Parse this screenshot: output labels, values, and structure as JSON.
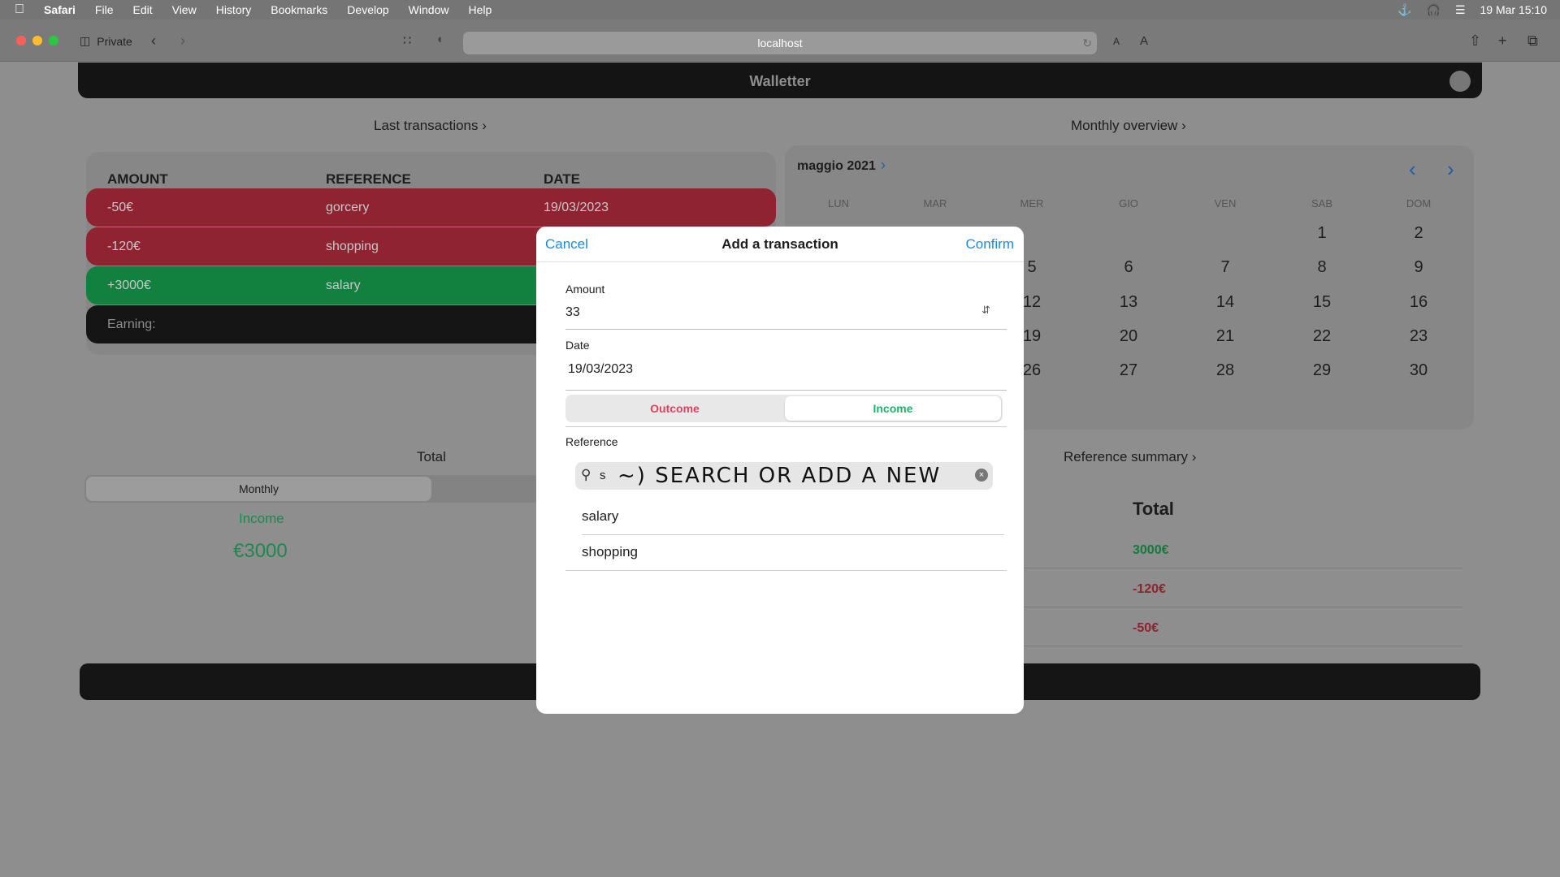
{
  "menubar": {
    "app": "Safari",
    "items": [
      "File",
      "Edit",
      "View",
      "History",
      "Bookmarks",
      "Develop",
      "Window",
      "Help"
    ],
    "datetime": "19 Mar  15:10"
  },
  "browser": {
    "private_label": "Private",
    "url": "localhost",
    "text_small": "A",
    "text_large": "A"
  },
  "app": {
    "title": "Walletter",
    "last_transactions": {
      "title": "Last transactions",
      "headers": [
        "AMOUNT",
        "REFERENCE",
        "DATE"
      ],
      "rows": [
        {
          "amount": "-50€",
          "reference": "gorcery",
          "date": "19/03/2023"
        },
        {
          "amount": "-120€",
          "reference": "shopping",
          "date": ""
        },
        {
          "amount": "+3000€",
          "reference": "salary",
          "date": ""
        }
      ],
      "earning_label": "Earning:"
    },
    "monthly_overview": {
      "title": "Monthly overview",
      "month": "maggio 2021",
      "weekdays": [
        "LUN",
        "MAR",
        "MER",
        "GIO",
        "VEN",
        "SAB",
        "DOM"
      ],
      "weeks": [
        [
          "",
          "",
          "",
          "",
          "",
          "1",
          "2"
        ],
        [
          "",
          "",
          "5",
          "6",
          "7",
          "8",
          "9"
        ],
        [
          "",
          "",
          "12",
          "13",
          "14",
          "15",
          "16"
        ],
        [
          "",
          "",
          "19",
          "20",
          "21",
          "22",
          "23"
        ],
        [
          "",
          "",
          "26",
          "27",
          "28",
          "29",
          "30"
        ]
      ]
    },
    "total": {
      "title": "Total",
      "segment": "Monthly",
      "income_label": "Income",
      "income_value": "€3000"
    },
    "reference_summary": {
      "title": "Reference summary",
      "column": "Total",
      "values": [
        "3000€",
        "-120€",
        "-50€"
      ]
    }
  },
  "modal": {
    "cancel": "Cancel",
    "title": "Add a transaction",
    "confirm": "Confirm",
    "amount_label": "Amount",
    "amount_value": "33",
    "date_label": "Date",
    "date_value": "19/03/2023",
    "segment_outcome": "Outcome",
    "segment_income": "Income",
    "reference_label": "Reference",
    "search_value": "s",
    "search_handwriting": "~) SEARCH OR ADD A NEW",
    "options": [
      "salary",
      "shopping"
    ]
  },
  "colors": {
    "outcome": "#e0405e",
    "income": "#1ab36a",
    "link": "#1e88e5"
  }
}
